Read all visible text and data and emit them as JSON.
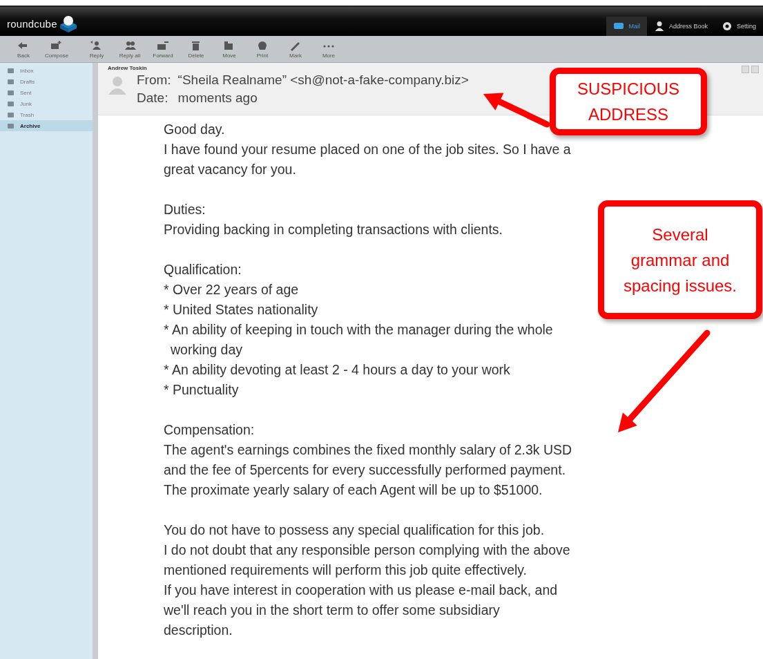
{
  "app": {
    "logo": "roundcube",
    "nav": [
      {
        "label": "Mail",
        "selected": true
      },
      {
        "label": "Address Book",
        "selected": false
      },
      {
        "label": "Setting",
        "selected": false
      }
    ]
  },
  "toolbar": [
    {
      "label": "Back"
    },
    {
      "label": "Compose"
    },
    {
      "label": "Reply"
    },
    {
      "label": "Reply all"
    },
    {
      "label": "Forward"
    },
    {
      "label": "Delete"
    },
    {
      "label": "Move"
    },
    {
      "label": "Print"
    },
    {
      "label": "Mark"
    },
    {
      "label": "More"
    }
  ],
  "folders": [
    {
      "name": "Inbox",
      "selected": false
    },
    {
      "name": "Drafts",
      "selected": false
    },
    {
      "name": "Sent",
      "selected": false
    },
    {
      "name": "Junk",
      "selected": false
    },
    {
      "name": "Trash",
      "selected": false
    },
    {
      "name": "Archive",
      "selected": true
    }
  ],
  "message": {
    "subject": "Andrew Toskin",
    "from_label": "From:",
    "from": "“Sheila Realname” <sh@not-a-fake-company.biz>",
    "date_label": "Date:",
    "date": "moments ago",
    "paragraphs": [
      [
        {
          "text": "Good day.",
          "kind": "line"
        },
        {
          "text": "I have found your resume placed on one of the job sites. So I have a",
          "kind": "line"
        },
        {
          "text": "great vacancy for you.",
          "kind": "line"
        }
      ],
      [
        {
          "text": "Duties:",
          "kind": "line"
        },
        {
          "text": "Providing backing in completing transactions with clients.",
          "kind": "line"
        }
      ],
      [
        {
          "text": "Qualification:",
          "kind": "line"
        },
        {
          "text": "* Over 22 years of age",
          "kind": "line"
        },
        {
          "text": "* United States nationality",
          "kind": "line"
        },
        {
          "text": "* An ability of keeping in touch with the manager during the whole",
          "kind": "line"
        },
        {
          "text": "working day",
          "kind": "continuation"
        },
        {
          "text": "* An ability devoting at least 2 - 4 hours a day to your work",
          "kind": "line"
        },
        {
          "text": "* Punctuality",
          "kind": "line"
        }
      ],
      [
        {
          "text": "Compensation:",
          "kind": "line"
        },
        {
          "text": "The agent's earnings combines the fixed monthly salary of 2.3k USD",
          "kind": "line"
        },
        {
          "text": "and the fee of 5percents for every successfully performed payment.",
          "kind": "line"
        },
        {
          "text": "The proximate yearly salary of each Agent will be up to $51000.",
          "kind": "line"
        }
      ],
      [
        {
          "text": "You do not have to possess any special qualification for this job.",
          "kind": "line"
        },
        {
          "text": "I do not doubt that any responsible person complying with the above",
          "kind": "line"
        },
        {
          "text": "mentioned requirements will perform this job quite effectively.",
          "kind": "line"
        },
        {
          "text": "If you have interest in cooperation with us please e-mail back, and",
          "kind": "line"
        },
        {
          "text": "we'll reach you in the short term to offer some subsidiary",
          "kind": "line"
        },
        {
          "text": "description.",
          "kind": "line"
        }
      ]
    ]
  },
  "callouts": [
    {
      "text": "SUSPICIOUS ADDRESS"
    },
    {
      "text": "Several grammar and spacing issues."
    }
  ]
}
